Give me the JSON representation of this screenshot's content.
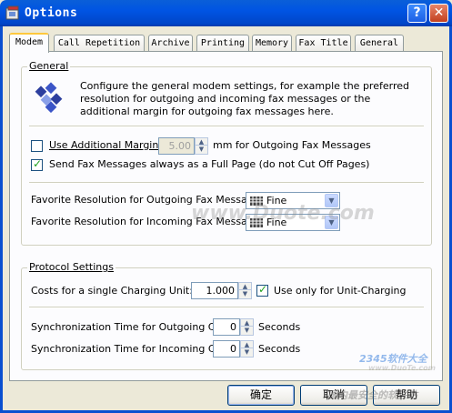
{
  "window": {
    "title": "Options",
    "help_btn": "?",
    "close_btn": "✕"
  },
  "tabs": [
    {
      "label": "Modem",
      "active": true
    },
    {
      "label": "Call Repetition"
    },
    {
      "label": "Archive"
    },
    {
      "label": "Printing"
    },
    {
      "label": "Memory"
    },
    {
      "label": "Fax Title"
    },
    {
      "label": "General"
    }
  ],
  "general": {
    "legend": "General",
    "description": "Configure the general modem settings, for example the preferred resolution for outgoing and incoming fax messages or the additional margin for outgoing fax messages here.",
    "margin_label": "Use Additional Margin of",
    "margin_checked": false,
    "margin_value": "5.00",
    "margin_unit": "mm for Outgoing Fax Messages",
    "fullpage_label": "Send Fax Messages always as a Full Page (do not Cut Off Pages)",
    "fullpage_checked": true,
    "res_out_label": "Favorite Resolution for Outgoing Fax Messages:",
    "res_out_value": "Fine",
    "res_in_label": "Favorite Resolution for Incoming Fax Messages:",
    "res_in_value": "Fine"
  },
  "protocol": {
    "legend": "Protocol Settings",
    "cost_label": "Costs for a single Charging Unit:",
    "cost_value": "1.000",
    "unit_charging_label": "Use only for Unit-Charging",
    "unit_charging_checked": true,
    "sync_out_label": "Synchronization Time for Outgoing Calls:",
    "sync_out_value": "0",
    "sync_in_label": "Synchronization Time for Incoming Calls:",
    "sync_in_value": "0",
    "seconds": "Seconds"
  },
  "buttons": {
    "ok": "确定",
    "cancel": "取消",
    "help": "帮助"
  },
  "watermarks": {
    "center": "www.Duote.com",
    "corner_brand": "2345软件大全",
    "corner_url": "www.DuoTe.com",
    "corner_text": "国内最安全的软件站"
  },
  "colors": {
    "titlebar": "#0054e3",
    "tab_highlight": "#ffc83c",
    "check": "#21a121"
  }
}
